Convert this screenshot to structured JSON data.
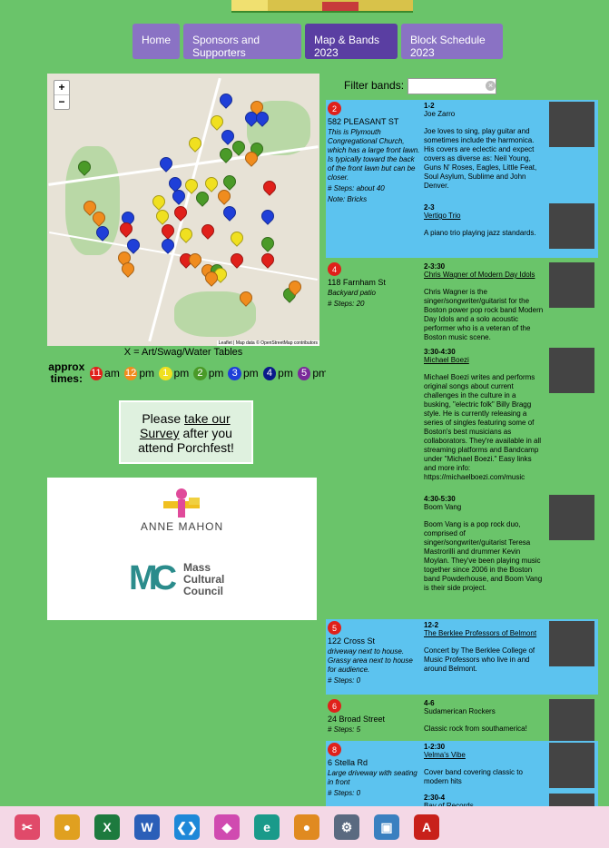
{
  "nav": {
    "tabs": [
      {
        "label": "Home"
      },
      {
        "label": "Sponsors and Supporters"
      },
      {
        "label": "Map & Bands 2023"
      },
      {
        "label": "Block Schedule 2023"
      }
    ]
  },
  "map": {
    "zoom_in": "+",
    "zoom_out": "−",
    "attribution": "Leaflet | Map data © OpenStreetMap contributors",
    "pins": [
      {
        "label": "9",
        "color": "#1f3fd8"
      },
      {
        "label": "10",
        "color": "#f08c1e"
      },
      {
        "label": "12",
        "color": "#1f3fd8"
      },
      {
        "label": "11",
        "color": "#1f3fd8"
      },
      {
        "label": "8",
        "color": "#f0e020"
      },
      {
        "label": "3",
        "color": "#1f3fd8"
      },
      {
        "label": "2",
        "color": "#f0e020"
      },
      {
        "label": "14",
        "color": "#4a9a28"
      },
      {
        "label": "15",
        "color": "#4a9a28"
      },
      {
        "label": "4",
        "color": "#4a9a28"
      },
      {
        "label": "16",
        "color": "#f08c1e"
      },
      {
        "label": "65",
        "color": "#4a9a28"
      },
      {
        "label": "17",
        "color": "#1f3fd8"
      },
      {
        "label": "18",
        "color": "#1f3fd8"
      },
      {
        "label": "19",
        "color": "#f0e020"
      },
      {
        "label": "67",
        "color": "#f0e020"
      },
      {
        "label": "20",
        "color": "#4a9a28"
      },
      {
        "label": "21",
        "color": "#e0201a"
      },
      {
        "label": "30",
        "color": "#1f3fd8"
      },
      {
        "label": "26",
        "color": "#f08c1e"
      },
      {
        "label": "29",
        "color": "#4a9a28"
      },
      {
        "label": "55",
        "color": "#f0e020"
      },
      {
        "label": "31",
        "color": "#e0201a"
      },
      {
        "label": "25",
        "color": "#1f3fd8"
      },
      {
        "label": "64",
        "color": "#f08c1e"
      },
      {
        "label": "63",
        "color": "#f08c1e"
      },
      {
        "label": "58",
        "color": "#1f3fd8"
      },
      {
        "label": "54",
        "color": "#f0e020"
      },
      {
        "label": "23",
        "color": "#1f3fd8"
      },
      {
        "label": "62",
        "color": "#1f3fd8"
      },
      {
        "label": "59",
        "color": "#e0201a"
      },
      {
        "label": "53",
        "color": "#e0201a"
      },
      {
        "label": "51",
        "color": "#f0e020"
      },
      {
        "label": "33",
        "color": "#e0201a"
      },
      {
        "label": "45",
        "color": "#f0e020"
      },
      {
        "label": "60",
        "color": "#1f3fd8"
      },
      {
        "label": "52",
        "color": "#1f3fd8"
      },
      {
        "label": "34",
        "color": "#4a9a28"
      },
      {
        "label": "68",
        "color": "#f08c1e"
      },
      {
        "label": "49",
        "color": "#e0201a"
      },
      {
        "label": "47",
        "color": "#f08c1e"
      },
      {
        "label": "44",
        "color": "#e0201a"
      },
      {
        "label": "36",
        "color": "#e0201a"
      },
      {
        "label": "69",
        "color": "#f08c1e"
      },
      {
        "label": "42",
        "color": "#f08c1e"
      },
      {
        "label": "43",
        "color": "#4a9a28"
      },
      {
        "label": "41",
        "color": "#f0e020"
      },
      {
        "label": "40",
        "color": "#f08c1e"
      },
      {
        "label": "39",
        "color": "#f08c1e"
      },
      {
        "label": "38",
        "color": "#4a9a28"
      },
      {
        "label": "37",
        "color": "#f08c1e"
      }
    ]
  },
  "legend": {
    "note": "X = Art/Swag/Water Tables",
    "label": "approx times:",
    "items": [
      {
        "num": "11",
        "unit": "am",
        "color": "#e0201a"
      },
      {
        "num": "12",
        "unit": "pm",
        "color": "#f08c1e"
      },
      {
        "num": "1",
        "unit": "pm",
        "color": "#f0e020"
      },
      {
        "num": "2",
        "unit": "pm",
        "color": "#4a9a28"
      },
      {
        "num": "3",
        "unit": "pm",
        "color": "#1f3fd8"
      },
      {
        "num": "4",
        "unit": "pm",
        "color": "#0a1a8a"
      },
      {
        "num": "5",
        "unit": "pm",
        "color": "#7a2a9a"
      }
    ]
  },
  "survey": {
    "pre": "Please ",
    "link": "take our Survey",
    "post": " after you attend Porchfest!"
  },
  "sponsors": {
    "anne": "ANNE MAHON",
    "mcc_letters": "MC",
    "mcc_l1": "Mass",
    "mcc_l2": "Cultural",
    "mcc_l3": "Council"
  },
  "filter": {
    "label": "Filter bands:",
    "placeholder": ""
  },
  "rows": [
    {
      "num": "2",
      "addr": "582 PLEASANT ST",
      "style": "blue",
      "desc": "This is Plymouth Congregational Church, which has a large front lawn. Is typically toward the back of the front lawn but can be closer.",
      "steps": "# Steps: about 40",
      "note": "Note: Bricks",
      "perfs": [
        {
          "time": "1-2",
          "band": "Joe Zarro",
          "link": false,
          "desc": "Joe loves to sing, play guitar and sometimes include the harmonica. His covers are eclectic and expect covers as diverse as: Neil Young, Guns N' Roses, Eagles, Little Feat, Soul Asylum, Sublime and John Denver."
        },
        {
          "time": "2-3",
          "band": "Vertigo Trio",
          "link": true,
          "desc": "A piano trio playing jazz standards."
        }
      ]
    },
    {
      "num": "4",
      "addr": "118 Farnham St",
      "style": "green",
      "desc": "Backyard patio",
      "steps": "# Steps: 20",
      "note": "",
      "perfs": [
        {
          "time": "2-3:30",
          "band": "Chris Wagner of Modern Day Idols",
          "link": true,
          "desc": "Chris Wagner is the singer/songwriter/guitarist for the Boston power pop rock band Modern Day Idols and a solo acoustic performer who is a veteran of the Boston music scene."
        },
        {
          "time": "3:30-4:30",
          "band": "Michael Boezi",
          "link": true,
          "desc": "Michael Boezi writes and performs original songs about current challenges in the culture in a busking, \"electric folk\" Billy Bragg style. He is currently releasing a series of singles featuring some of Boston's best musicians as collaborators. They're available in all streaming platforms and Bandcamp under \"Michael Boezi.\" Easy links and more info: https://michaelboezi.com/music"
        },
        {
          "time": "4:30-5:30",
          "band": "Boom Vang",
          "link": false,
          "desc": "Boom Vang is a pop rock duo, comprised of singer/songwriter/guitarist Teresa Mastrorilli and drummer Kevin Moylan. They've been playing music together since 2006 in the Boston band Powderhouse, and Boom Vang is their side project."
        }
      ]
    },
    {
      "num": "5",
      "addr": "122 Cross St",
      "style": "blue",
      "desc": "driveway next to house. Grassy area next to house for audience.",
      "steps": "# Steps: 0",
      "note": "",
      "perfs": [
        {
          "time": "12-2",
          "band": "The Berklee Professors of Belmont",
          "link": true,
          "desc": "Concert by The Berklee College of Music Professors who live in and around Belmont."
        }
      ]
    },
    {
      "num": "6",
      "addr": "24 Broad Street",
      "style": "green",
      "desc": "",
      "steps": "# Steps: 5",
      "note": "",
      "perfs": [
        {
          "time": "4-6",
          "band": "Sudamerican Rockers",
          "link": false,
          "desc": "Classic rock from southamerica!"
        }
      ]
    },
    {
      "num": "8",
      "addr": "6 Stella Rd",
      "style": "blue",
      "desc": "Large driveway with seating in front",
      "steps": "# Steps: 0",
      "note": "",
      "perfs": [
        {
          "time": "1-2:30",
          "band": "Velma's Vibe",
          "link": true,
          "desc": "Cover band covering classic to modern hits"
        },
        {
          "time": "2:30-4",
          "band": "Bay of Records",
          "link": true,
          "desc": ""
        }
      ]
    }
  ],
  "taskbar": {
    "items": [
      {
        "name": "snipping-tool-icon",
        "color": "#e04a6a",
        "glyph": "✂"
      },
      {
        "name": "chrome-icon",
        "color": "#e0a020",
        "glyph": "●"
      },
      {
        "name": "excel-icon",
        "color": "#1d7a3e",
        "glyph": "X"
      },
      {
        "name": "word-icon",
        "color": "#2b5fb8",
        "glyph": "W"
      },
      {
        "name": "vscode-icon",
        "color": "#1e88d8",
        "glyph": "❮❯"
      },
      {
        "name": "gemini-icon",
        "color": "#d04ab0",
        "glyph": "◆"
      },
      {
        "name": "edge-icon",
        "color": "#1a9a8a",
        "glyph": "e"
      },
      {
        "name": "chrome-canary-icon",
        "color": "#e08a20",
        "glyph": "●"
      },
      {
        "name": "settings-icon",
        "color": "#5a6a80",
        "glyph": "⚙"
      },
      {
        "name": "photos-icon",
        "color": "#3a80c0",
        "glyph": "▣"
      },
      {
        "name": "acrobat-icon",
        "color": "#c8201a",
        "glyph": "A"
      }
    ]
  }
}
